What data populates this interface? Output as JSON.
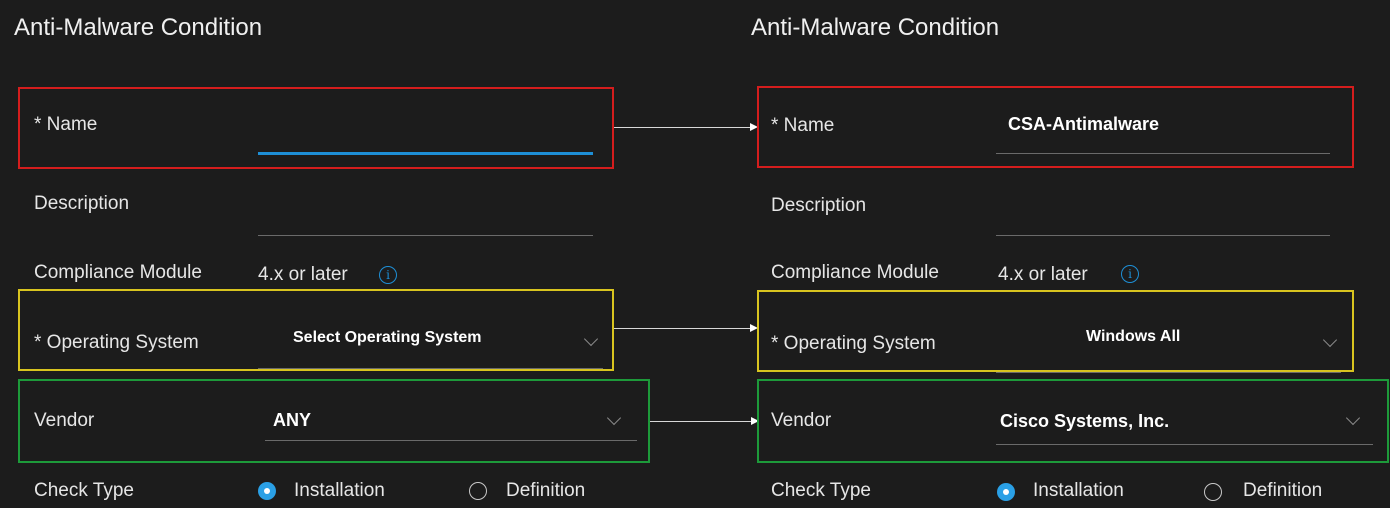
{
  "left": {
    "title": "Anti-Malware Condition",
    "name_label": "* Name",
    "name_value": "",
    "description_label": "Description",
    "description_value": "",
    "compliance_label": "Compliance Module",
    "compliance_value": "4.x or later",
    "os_label": "* Operating System",
    "os_value": "Select Operating System",
    "vendor_label": "Vendor",
    "vendor_value": "ANY",
    "check_type_label": "Check Type",
    "check_type_options": [
      "Installation",
      "Definition"
    ],
    "check_type_selected": "Installation"
  },
  "right": {
    "title": "Anti-Malware Condition",
    "name_label": "* Name",
    "name_value": "CSA-Antimalware",
    "description_label": "Description",
    "description_value": "",
    "compliance_label": "Compliance Module",
    "compliance_value": "4.x or later",
    "os_label": "* Operating System",
    "os_value": "Windows All",
    "vendor_label": "Vendor",
    "vendor_value": "Cisco Systems, Inc.",
    "check_type_label": "Check Type",
    "check_type_options": [
      "Installation",
      "Definition"
    ],
    "check_type_selected": "Installation"
  },
  "icons": {
    "info": "info-icon",
    "dropdown": "chevron-down-icon",
    "arrow": "arrow-right-icon",
    "info_glyph": "i"
  },
  "colors": {
    "background": "#1c1c1c",
    "accent": "#1e8fd6",
    "highlight_name": "#d41d1d",
    "highlight_os": "#d8c41f",
    "highlight_vendor": "#1d9a3a"
  }
}
